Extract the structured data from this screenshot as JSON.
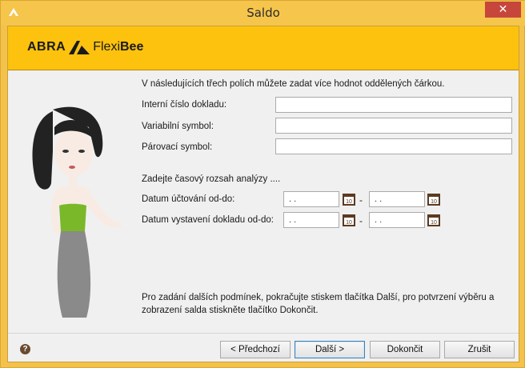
{
  "window": {
    "title": "Saldo",
    "close_glyph": "✕",
    "app_icon": "abra-logo-icon"
  },
  "banner": {
    "brand_left": "ABRA",
    "brand_flexi": "Flexi",
    "brand_bee": "Bee",
    "accent": "#fcc20e"
  },
  "form": {
    "intro": "V následujících třech polích můžete zadat více hodnot oddělených čárkou.",
    "fields": [
      {
        "label": "Interní číslo dokladu:",
        "value": ""
      },
      {
        "label": "Variabilní symbol:",
        "value": ""
      },
      {
        "label": "Párovací symbol:",
        "value": ""
      }
    ],
    "range_intro": "Zadejte časový rozsah analýzy ....",
    "ranges": [
      {
        "label": "Datum účtování od-do:",
        "from": " .  .",
        "to": " .  .",
        "separator": "-"
      },
      {
        "label": "Datum vystavení dokladu od-do:",
        "from": " .  .",
        "to": " .  .",
        "separator": "-"
      }
    ],
    "calendar_day": "10"
  },
  "footer": {
    "note": "Pro zadání dalších podmínek, pokračujte stiskem tlačítka Další, pro potvrzení výběru a zobrazení salda stiskněte tlačítko Dokončit.",
    "help_glyph": "?",
    "buttons": {
      "prev": "< Předchozí",
      "next": "Další >",
      "finish": "Dokončit",
      "cancel": "Zrušit"
    }
  }
}
